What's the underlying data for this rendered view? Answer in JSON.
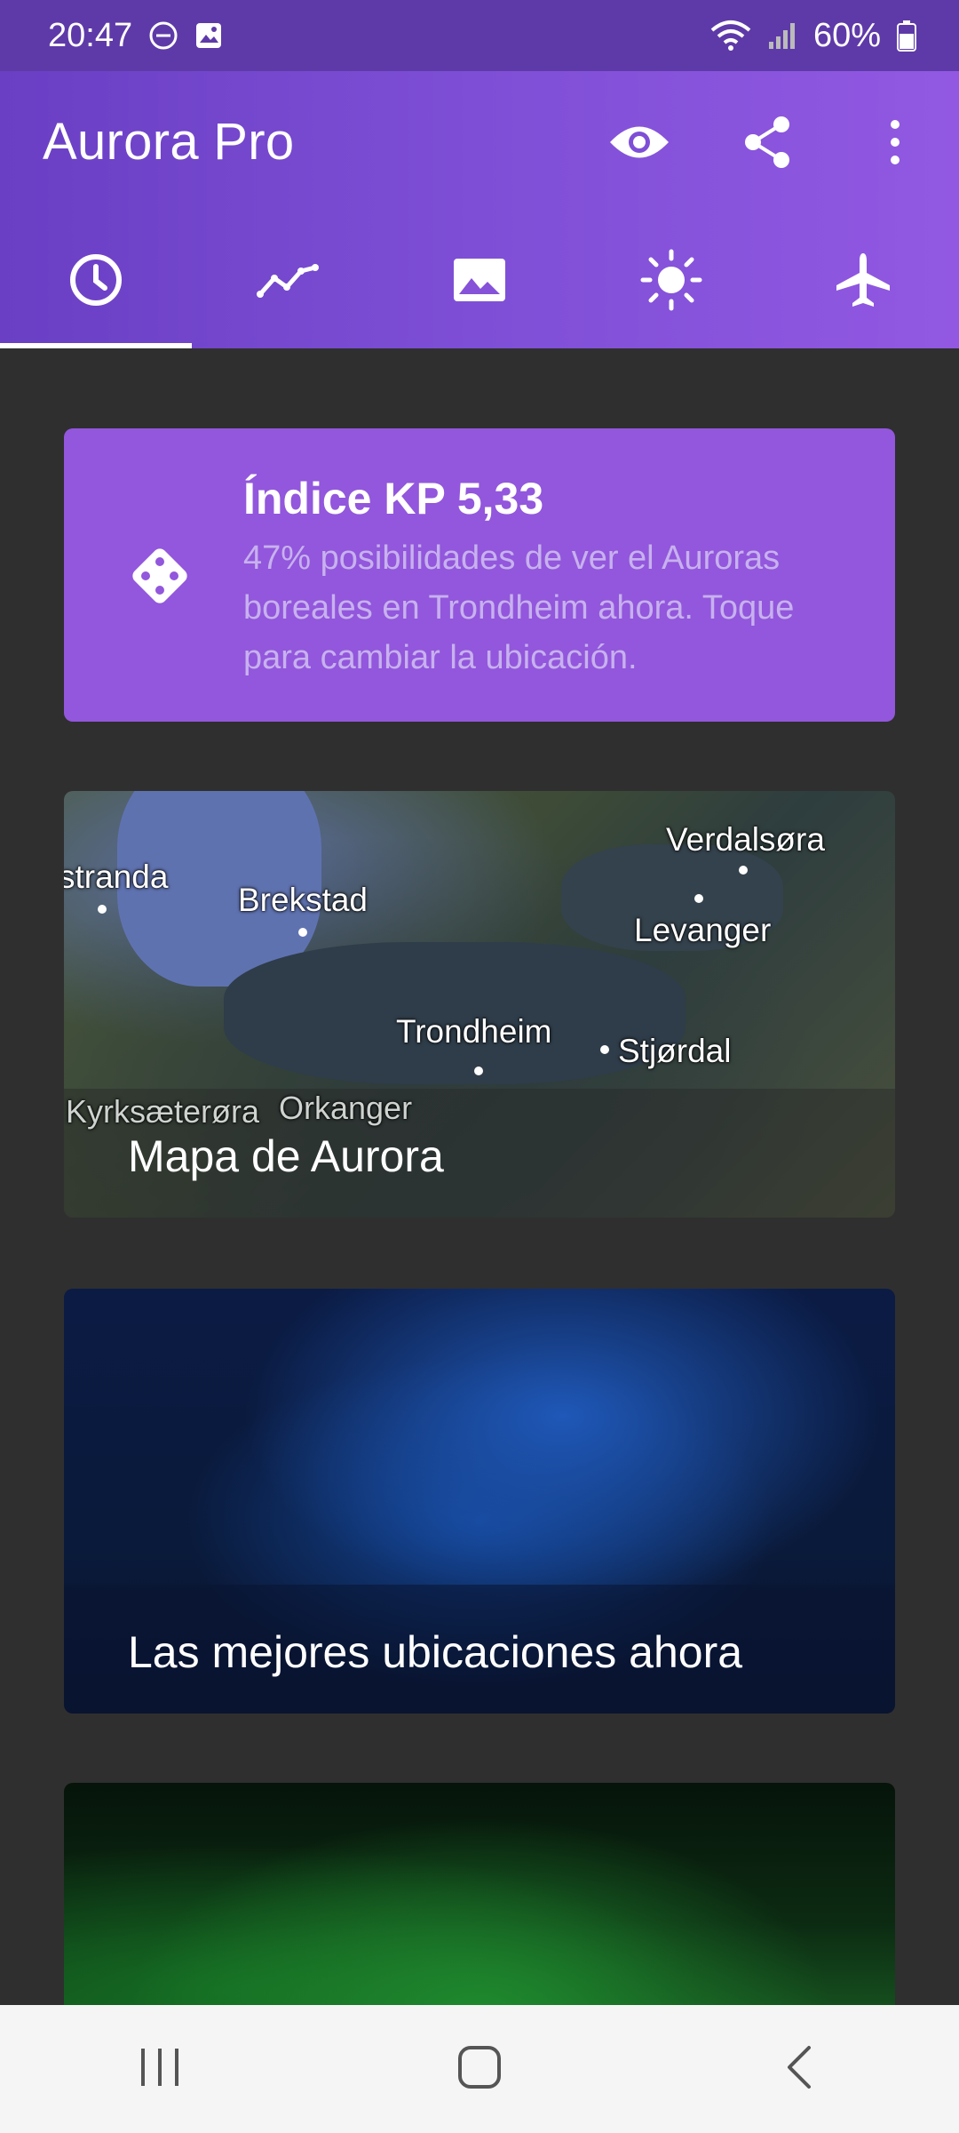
{
  "status_bar": {
    "time": "20:47",
    "battery": "60%",
    "icons": [
      "do-not-disturb-icon",
      "image-icon",
      "wifi-icon",
      "signal-icon",
      "battery-icon"
    ]
  },
  "app_bar": {
    "title": "Aurora Pro",
    "actions": [
      "eye-icon",
      "share-icon",
      "more-vert-icon"
    ],
    "tabs": [
      "clock-icon",
      "trend-icon",
      "image-icon",
      "sun-icon",
      "airplane-icon"
    ],
    "active_tab": 0
  },
  "kp_card": {
    "title": "Índice KP 5,33",
    "text": "47% posibilidades de ver el Auroras boreales en Trondheim ahora. Toque para cambiar la ubicación.",
    "icon": "dice-icon"
  },
  "map_card": {
    "title": "Mapa de Aurora",
    "labels": {
      "stranda": "stranda",
      "brekstad": "Brekstad",
      "verdalsora": "Verdalsøra",
      "levanger": "Levanger",
      "trondheim": "Trondheim",
      "stjordal": "Stjørdal",
      "kyrksaeterora": "Kyrksæterøra",
      "orkanger": "Orkanger"
    }
  },
  "locations_card": {
    "title": "Las mejores ubicaciones ahora"
  },
  "nav_bar": {
    "buttons": [
      "recents-icon",
      "home-icon",
      "back-icon"
    ]
  },
  "colors": {
    "status_bar": "#5e3aa8",
    "app_bar_start": "#6a3fc4",
    "app_bar_end": "#9258e2",
    "kp_card": "#9257dc",
    "background": "#2f2f2f"
  }
}
